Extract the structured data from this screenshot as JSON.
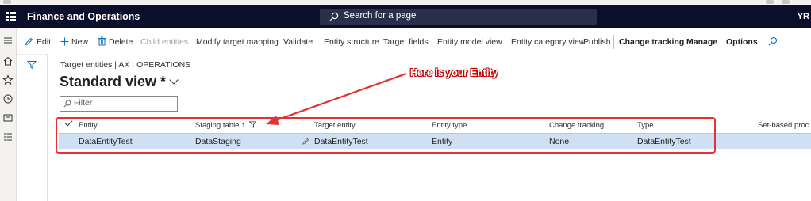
{
  "app": {
    "title": "Finance and Operations",
    "search_placeholder": "Search for a page",
    "user_initials": "YR"
  },
  "action_pane": {
    "edit": "Edit",
    "new": "New",
    "delete": "Delete",
    "child_entities": "Child entities",
    "modify_target_mapping": "Modify target mapping",
    "validate": "Validate",
    "entity_structure": "Entity structure",
    "target_fields": "Target fields",
    "entity_model_view": "Entity model view",
    "entity_category_view": "Entity category view",
    "publish": "Publish",
    "change_tracking": "Change tracking",
    "manage": "Manage",
    "options": "Options"
  },
  "page": {
    "breadcrumb": "Target entities  |  AX : OPERATIONS",
    "view_title": "Standard view *",
    "filter_placeholder": "Filter"
  },
  "grid": {
    "columns": [
      "Entity",
      "Staging table ↑",
      "Target entity",
      "Entity type",
      "Change tracking",
      "Type",
      "Set-based proc..."
    ],
    "rows": [
      {
        "entity": "DataEntityTest",
        "staging_table": "DataStaging",
        "target_entity": "DataEntityTest",
        "entity_type": "Entity",
        "change_tracking": "None",
        "type": "DataEntityTest",
        "set_based": ""
      }
    ]
  },
  "annotation": {
    "callout_text": "Here is your Entity",
    "color": "#e23232"
  },
  "colors": {
    "titlebar": "#0b0f2b",
    "selected_row": "#cfe0f5",
    "accent": "#0f6cbd"
  }
}
